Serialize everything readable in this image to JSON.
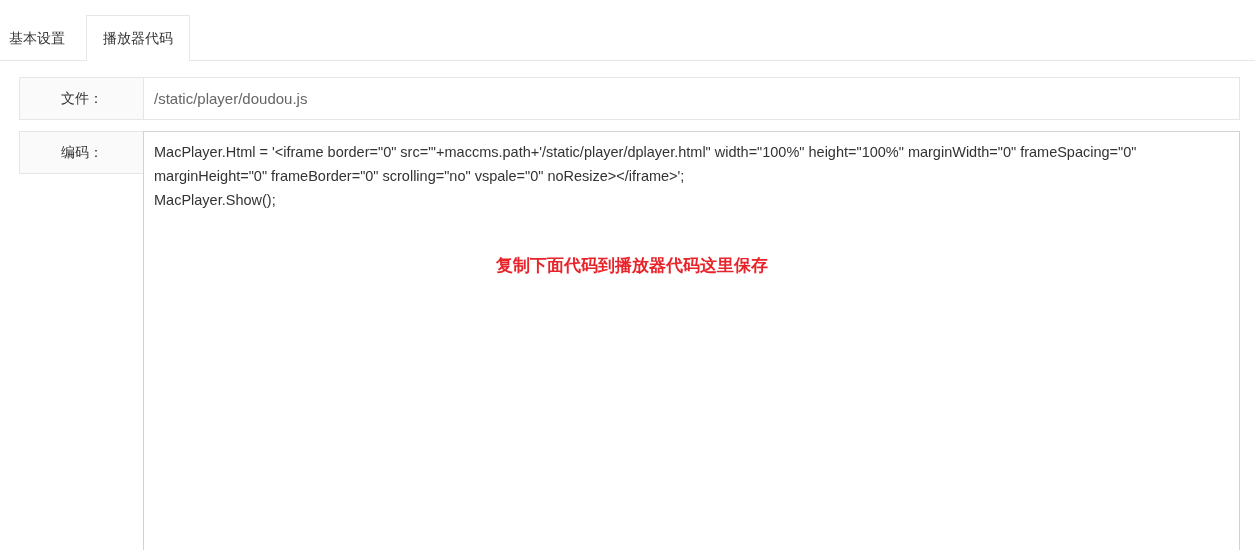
{
  "tabs": [
    {
      "label": "基本设置",
      "selected": false
    },
    {
      "label": "播放器代码",
      "selected": true
    }
  ],
  "form": {
    "fields": [
      {
        "kind": "input",
        "label": "文件：",
        "value": "/static/player/doudou.js"
      },
      {
        "kind": "textarea",
        "label": "编码：",
        "value": "MacPlayer.Html = '<iframe border=\"0\" src=\"'+maccms.path+'/static/player/dplayer.html\" width=\"100%\" height=\"100%\" marginWidth=\"0\" frameSpacing=\"0\" marginHeight=\"0\" frameBorder=\"0\" scrolling=\"no\" vspale=\"0\" noResize></iframe>';\nMacPlayer.Show();",
        "annotation": "复制下面代码到播放器代码这里保存"
      }
    ]
  }
}
